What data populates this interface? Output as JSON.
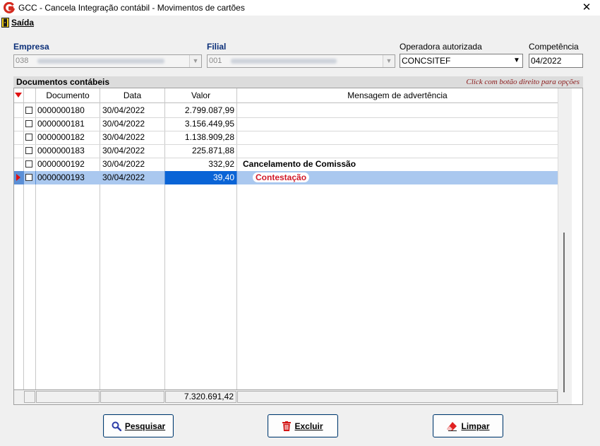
{
  "window": {
    "title": "GCC - Cancela Integração contábil - Movimentos de cartões",
    "close_glyph": "✕"
  },
  "menu": {
    "exit_label": "Saída"
  },
  "form": {
    "empresa": {
      "label": "Empresa",
      "value": "038"
    },
    "filial": {
      "label": "Filial",
      "value": "001"
    },
    "operadora": {
      "label": "Operadora autorizada",
      "value": "CONCSITEF"
    },
    "competencia": {
      "label": "Competência",
      "value": "04/2022"
    }
  },
  "grid": {
    "title": "Documentos contábeis",
    "hint": "Click com botão direito para opções",
    "columns": [
      "Documento",
      "Data",
      "Valor",
      "Mensagem de advertência"
    ],
    "rows": [
      {
        "documento": "0000000180",
        "data": "30/04/2022",
        "valor": "2.799.087,99",
        "mensagem": "",
        "checked": false,
        "selected": false
      },
      {
        "documento": "0000000181",
        "data": "30/04/2022",
        "valor": "3.156.449,95",
        "mensagem": "",
        "checked": false,
        "selected": false
      },
      {
        "documento": "0000000182",
        "data": "30/04/2022",
        "valor": "1.138.909,28",
        "mensagem": "",
        "checked": false,
        "selected": false
      },
      {
        "documento": "0000000183",
        "data": "30/04/2022",
        "valor": "225.871,88",
        "mensagem": "",
        "checked": false,
        "selected": false
      },
      {
        "documento": "0000000192",
        "data": "30/04/2022",
        "valor": "332,92",
        "mensagem": "Cancelamento de Comissão",
        "checked": false,
        "selected": false
      },
      {
        "documento": "0000000193",
        "data": "30/04/2022",
        "valor": "39,40",
        "mensagem": "Contestação",
        "checked": false,
        "selected": true
      }
    ],
    "total": "7.320.691,42"
  },
  "buttons": {
    "pesquisar": "Pesquisar",
    "excluir": "Excluir",
    "limpar": "Limpar"
  },
  "colors": {
    "label_blue": "#0b2f79",
    "selection": "#5b8fd6",
    "value_selection": "#0a64d6",
    "warn_blue": "#1a25d4",
    "warn_red": "#d11a2a",
    "hint": "#8b1a1a"
  }
}
